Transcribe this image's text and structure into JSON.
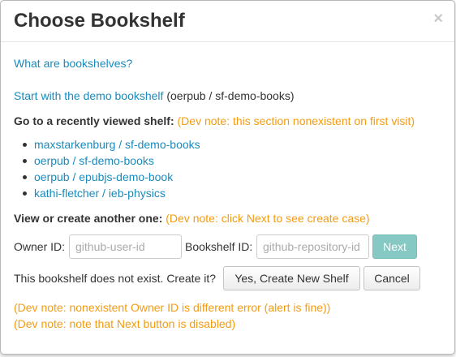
{
  "modal": {
    "title": "Choose Bookshelf",
    "close_symbol": "×"
  },
  "what_link": "What are bookshelves?",
  "demo": {
    "link": "Start with the demo bookshelf",
    "suffix": "(oerpub / sf-demo-books)"
  },
  "recent": {
    "heading": "Go to a recently viewed shelf:",
    "note": "(Dev note: this section nonexistent on first visit)",
    "items": [
      "maxstarkenburg / sf-demo-books",
      "oerpub / sf-demo-books",
      "oerpub / epubjs-demo-book",
      "kathi-fletcher / ieb-physics"
    ]
  },
  "create": {
    "heading": "View or create another one:",
    "note": "(Dev note: click Next to see create case)"
  },
  "form": {
    "owner_label": "Owner ID:",
    "owner_placeholder": "github-user-id",
    "shelf_label": "Bookshelf ID:",
    "shelf_placeholder": "github-repository-id",
    "next_label": "Next"
  },
  "confirm": {
    "text": "This bookshelf does not exist. Create it?",
    "yes_label": "Yes, Create New Shelf",
    "cancel_label": "Cancel"
  },
  "dev_notes": [
    "(Dev note: nonexistent Owner ID is different error (alert is fine))",
    "(Dev note: note that Next button is disabled)"
  ],
  "colors": {
    "link": "#1a8bbd",
    "note": "#f39c12",
    "next_disabled": "#86c8c4"
  }
}
